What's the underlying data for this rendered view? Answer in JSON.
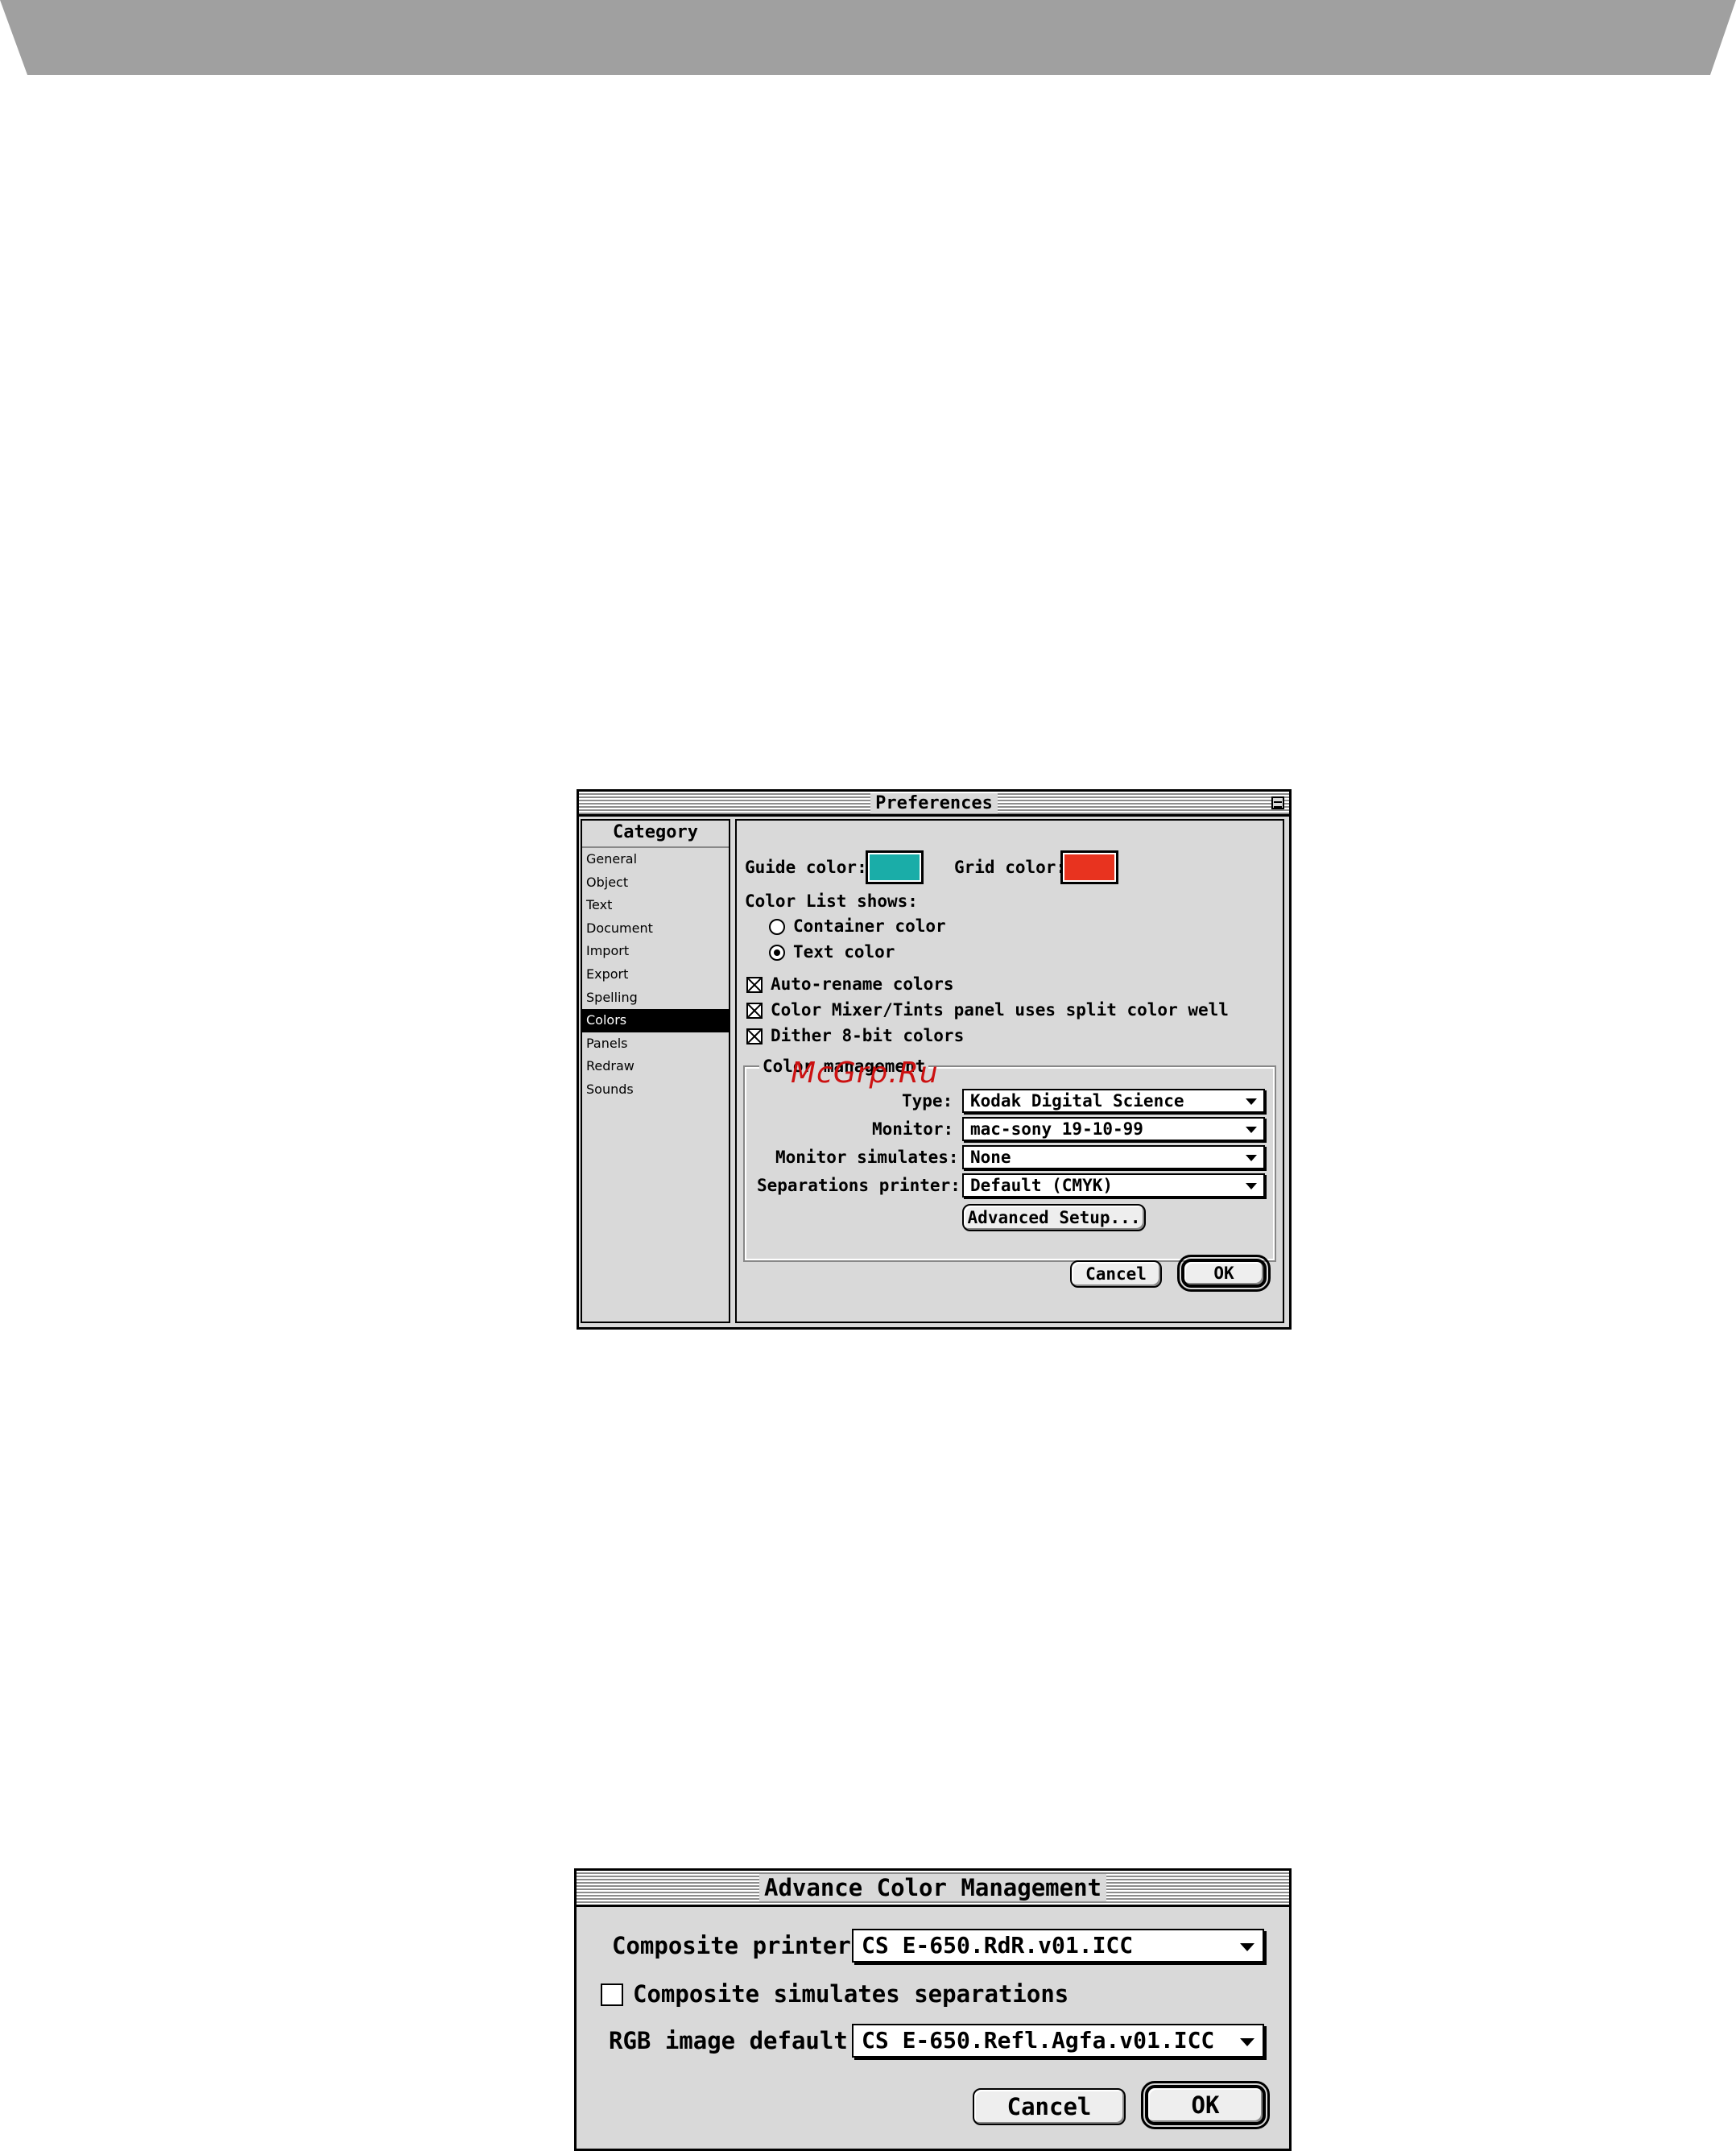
{
  "preferences": {
    "title": "Preferences",
    "category_header": "Category",
    "categories": [
      "General",
      "Object",
      "Text",
      "Document",
      "Import",
      "Export",
      "Spelling",
      "Colors",
      "Panels",
      "Redraw",
      "Sounds"
    ],
    "selected_category": "Colors",
    "guide_color_label": "Guide color:",
    "guide_color": "#1aada8",
    "grid_color_label": "Grid color:",
    "grid_color": "#e8331f",
    "color_list_shows_label": "Color List shows:",
    "radio_container_label": "Container color",
    "radio_text_label": "Text color",
    "radio_selected": "Text color",
    "auto_rename_label": "Auto-rename colors",
    "auto_rename_checked": true,
    "split_well_label": "Color Mixer/Tints panel uses split color well",
    "split_well_checked": true,
    "dither_label": "Dither 8-bit colors",
    "dither_checked": true,
    "color_management_title": "Color management",
    "type_label": "Type:",
    "type_value": "Kodak Digital Science",
    "monitor_label": "Monitor:",
    "monitor_value": "mac-sony 19-10-99",
    "monitor_simulates_label": "Monitor simulates:",
    "monitor_simulates_value": "None",
    "separations_printer_label": "Separations printer:",
    "separations_printer_value": "Default (CMYK)",
    "advanced_setup_label": "Advanced Setup...",
    "cancel_label": "Cancel",
    "ok_label": "OK"
  },
  "watermark": "McGrp.Ru",
  "advanced_color_management": {
    "title": "Advance Color Management",
    "composite_printer_label": "Composite printer:",
    "composite_printer_value": "CS E-650.RdR.v01.ICC",
    "composite_simulates_label": "Composite simulates separations",
    "composite_simulates_checked": false,
    "rgb_default_label": "RGB image default:",
    "rgb_default_value": "CS E-650.Refl.Agfa.v01.ICC",
    "cancel_label": "Cancel",
    "ok_label": "OK"
  }
}
